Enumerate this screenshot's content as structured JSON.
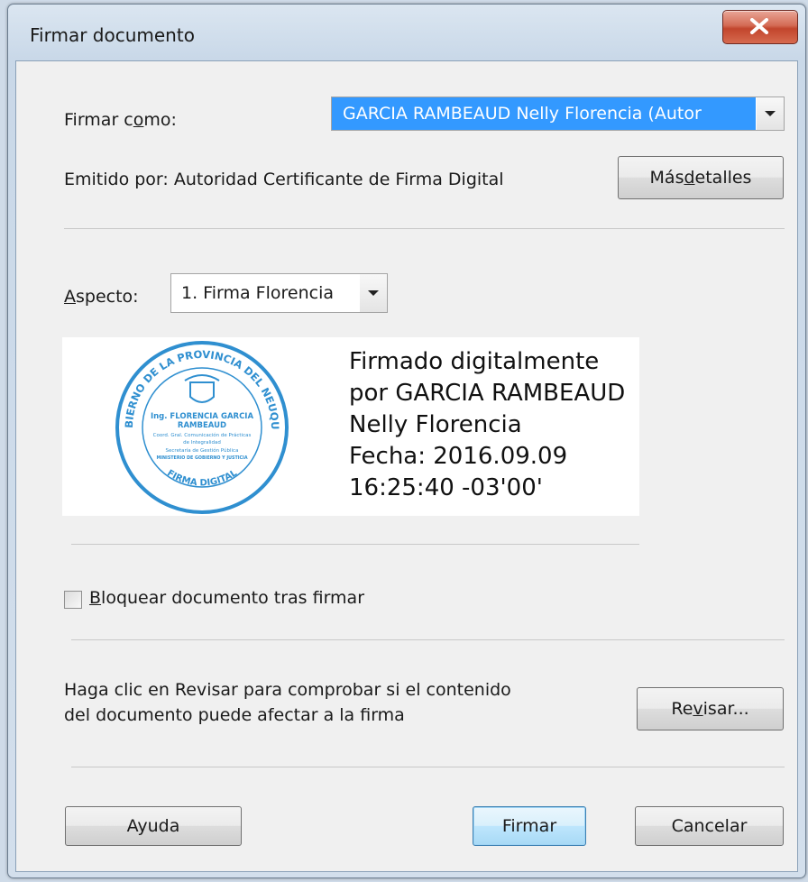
{
  "window": {
    "title": "Firmar documento"
  },
  "sign_as": {
    "label_pre": "Firmar c",
    "label_key": "o",
    "label_post": "mo:",
    "value": "GARCIA RAMBEAUD Nelly Florencia (Autor"
  },
  "issued_by": "Emitido por: Autoridad Certificante de Firma Digital",
  "more_details": {
    "pre": "Más ",
    "key": "d",
    "post": "etalles"
  },
  "aspect": {
    "label_key": "A",
    "label_post": "specto:",
    "value": "1. Firma Florencia"
  },
  "stamp": {
    "arc_top": "GOBIERNO DE LA PROVINCIA DEL NEUQUÉN",
    "arc_bottom": "FIRMA DIGITAL",
    "lines": [
      "Ing. FLORENCIA GARCIA",
      "RAMBEAUD",
      "Coord. Gral. Comunicación de Prácticas",
      "de Integralidad",
      "Secretaría de Gestión Pública",
      "MINISTERIO DE GOBIERNO Y JUSTICIA"
    ]
  },
  "signature_lines": [
    "Firmado digitalmente",
    "por GARCIA RAMBEAUD",
    "Nelly Florencia",
    "Fecha: 2016.09.09",
    "16:25:40 -03'00'"
  ],
  "lock": {
    "key": "B",
    "post": "loquear documento tras firmar",
    "checked": false
  },
  "review_text": [
    "Haga clic en Revisar para comprobar si el contenido",
    "del documento puede afectar a la firma"
  ],
  "review_button": {
    "pre": "Re",
    "key": "v",
    "post": "isar..."
  },
  "buttons": {
    "help": "Ayuda",
    "sign": "Firmar",
    "cancel": "Cancelar"
  },
  "colors": {
    "selection": "#3399ff",
    "stamp_blue": "#2f8fd0",
    "close_red": "#c2452c"
  }
}
